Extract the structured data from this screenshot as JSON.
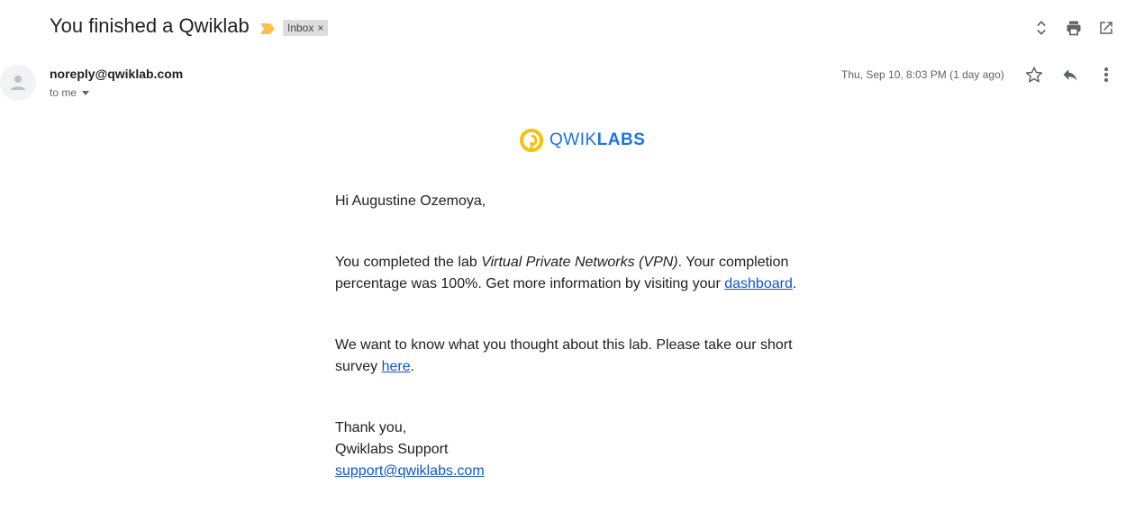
{
  "subject": "You finished a Qwiklab",
  "label": {
    "text": "Inbox",
    "remove": "×"
  },
  "icons": {
    "importance": "importance-marker-icon",
    "expand": "expand-collapse-icon",
    "print": "print-icon",
    "popout": "open-in-new-window-icon",
    "avatar": "person-icon",
    "star": "star-icon",
    "reply": "reply-icon",
    "more": "more-vert-icon",
    "logo": "qwiklabs-logo-icon"
  },
  "colors": {
    "accent": "#1a73e8",
    "link": "#1155cc",
    "importance": "#f6c34b",
    "logo_ring": "#f4c20d"
  },
  "sender": {
    "email": "noreply@qwiklab.com",
    "to": "to me",
    "date": "Thu, Sep 10, 8:03 PM (1 day ago)"
  },
  "logo": {
    "part1": "QWIK",
    "part2": "LABS"
  },
  "body": {
    "greeting": "Hi Augustine Ozemoya,",
    "p1_a": "You completed the lab ",
    "p1_lab": "Virtual Private Networks (VPN)",
    "p1_b": ". Your completion percentage was 100%. Get more information by visiting your ",
    "p1_link": "dashboard",
    "p1_end": ".",
    "p2_a": "We want to know what you thought about this lab. Please take our short survey ",
    "p2_link": "here",
    "p2_end": ".",
    "thanks": "Thank you,",
    "team": "Qwiklabs Support",
    "support_email": "support@qwiklabs.com"
  }
}
